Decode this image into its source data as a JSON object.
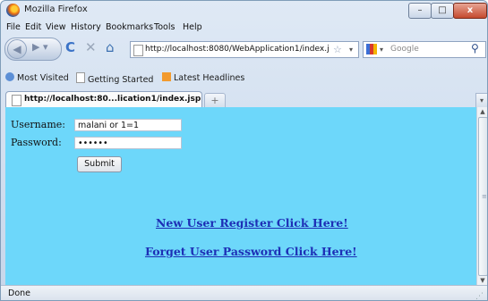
{
  "window": {
    "title": "Mozilla Firefox",
    "controls": {
      "minimize": "–",
      "maximize": "□",
      "close": "x"
    }
  },
  "menu": [
    "File",
    "Edit",
    "View",
    "History",
    "Bookmarks",
    "Tools",
    "Help"
  ],
  "nav": {
    "back_icon": "back-arrow-icon",
    "forward_icon": "forward-arrow-icon",
    "url": "http://localhost:8080/WebApplication1/index.j",
    "search_placeholder": "Google"
  },
  "bookmarks": [
    "Most Visited",
    "Getting Started",
    "Latest Headlines"
  ],
  "tabs": [
    {
      "title": "http://localhost:80...lication1/index.jsp"
    }
  ],
  "form": {
    "username_label": "Username:",
    "username_value": "malani or 1=1",
    "password_label": "Password:",
    "password_value": "••••••",
    "submit_label": "Submit"
  },
  "links": {
    "register": "New User Register Click Here!",
    "forgot": "Forget User Password Click Here!"
  },
  "status": {
    "text": "Done"
  },
  "colors": {
    "page_background": "#6dd7fa",
    "link": "#1d2fb6"
  }
}
